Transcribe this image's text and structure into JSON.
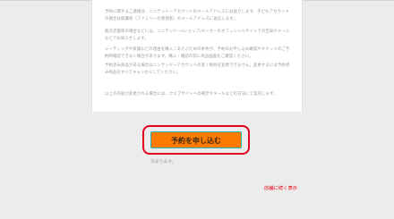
{
  "notice": {
    "paragraph_1": "予約に関するご連絡は、ニンテンドーアカウントのメールアドレスにお送りします。子どもアカウントの場合は保護者（ファミリーの管理者）のメールアドレスに送信します。",
    "paragraph_2": "販売店舗等の場合などには、ニンテンドーeショップ/メーカーのオフィシャルサイトでの告知やメールなどでお知らせします。",
    "paragraph_3": "レーティングや保護などの理由を購入 / あそぶための条件が、予約のお申し込み確認やチケットのご予約時確認できない場合があります。購入・確認の前に商品画面をご確認ください。",
    "paragraph_4": "予約済み商品がある場合はニンテンドーアカウントの退 / 削除を変更できません。変更するには予約済み商品をすべてキャンセルしてください。",
    "paragraph_5": "以上の内容が変更される場合には、ウェブサイトへの掲示やメールなどの方法にて案内します。"
  },
  "reserve_button": {
    "label": "予約を申し込む"
  },
  "status_text": "決まります。",
  "continue_link": {
    "label": "店舗に続く表示"
  }
}
